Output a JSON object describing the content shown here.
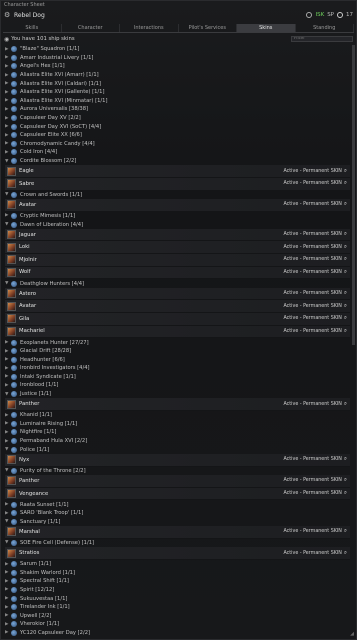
{
  "window": {
    "title": "Character Sheet"
  },
  "header": {
    "character": "Rebel Dog",
    "isk": "ISK",
    "sp": "SP",
    "skillq": "17"
  },
  "tabs": [
    "Skills",
    "Character",
    "Interactions",
    "Pilot's Services",
    "Skins",
    "Standing"
  ],
  "active_tab": 4,
  "count_text": "You have 101 ship skins",
  "filter_placeholder": "Filter",
  "status_label": "Active - Permanent SKIN",
  "rows": [
    {
      "t": "g",
      "exp": false,
      "label": "\"Blaze\" Squadron [1/1]"
    },
    {
      "t": "g",
      "exp": false,
      "label": "Amarr Industrial Livery [1/1]"
    },
    {
      "t": "g",
      "exp": false,
      "label": "Angel's Hex [1/1]"
    },
    {
      "t": "g",
      "exp": false,
      "label": "Aliastra Elite XVI (Amarr) [1/1]"
    },
    {
      "t": "g",
      "exp": false,
      "label": "Aliastra Elite XVI (Caldari) [1/1]"
    },
    {
      "t": "g",
      "exp": false,
      "label": "Aliastra Elite XVI (Gallente) [1/1]"
    },
    {
      "t": "g",
      "exp": false,
      "label": "Aliastra Elite XVI (Minmatar) [1/1]"
    },
    {
      "t": "g",
      "exp": false,
      "label": "Aurora Universalis [38/38]"
    },
    {
      "t": "g",
      "exp": false,
      "label": "Capsuleer Day XV [2/2]"
    },
    {
      "t": "g",
      "exp": false,
      "label": "Capsuleer Day XVI (SoCT) [4/4]"
    },
    {
      "t": "g",
      "exp": false,
      "label": "Capsuleer Elite XX [6/6]"
    },
    {
      "t": "g",
      "exp": false,
      "label": "Chromodynamic Candy [4/4]"
    },
    {
      "t": "g",
      "exp": false,
      "label": "Cold Iron [4/4]"
    },
    {
      "t": "g",
      "exp": true,
      "label": "Cordite Blossom [2/2]"
    },
    {
      "t": "i",
      "label": "Eagle"
    },
    {
      "t": "i",
      "label": "Sabre"
    },
    {
      "t": "g",
      "exp": true,
      "label": "Crown and Swords [1/1]"
    },
    {
      "t": "i",
      "label": "Avatar"
    },
    {
      "t": "g",
      "exp": false,
      "label": "Cryptic Mimesis [1/1]"
    },
    {
      "t": "g",
      "exp": true,
      "label": "Dawn of Liberation [4/4]"
    },
    {
      "t": "i",
      "label": "Jaguar"
    },
    {
      "t": "i",
      "label": "Loki"
    },
    {
      "t": "i",
      "label": "Mjolnir"
    },
    {
      "t": "i",
      "label": "Wolf"
    },
    {
      "t": "g",
      "exp": true,
      "label": "Deathglow Hunters [4/4]"
    },
    {
      "t": "i",
      "label": "Astero"
    },
    {
      "t": "i",
      "label": "Avatar"
    },
    {
      "t": "i",
      "label": "Gila"
    },
    {
      "t": "i",
      "label": "Machariel"
    },
    {
      "t": "g",
      "exp": false,
      "label": "Exoplanets Hunter [27/27]"
    },
    {
      "t": "g",
      "exp": false,
      "label": "Glacial Drift [28/28]"
    },
    {
      "t": "g",
      "exp": false,
      "label": "Headhunter [6/6]"
    },
    {
      "t": "g",
      "exp": false,
      "label": "Ironbird Investigators [4/4]"
    },
    {
      "t": "g",
      "exp": false,
      "label": "Intaki Syndicate [1/1]"
    },
    {
      "t": "g",
      "exp": false,
      "label": "Ironblood [1/1]"
    },
    {
      "t": "g",
      "exp": true,
      "label": "Justice [1/1]"
    },
    {
      "t": "i",
      "label": "Panther"
    },
    {
      "t": "g",
      "exp": false,
      "label": "Khanid [1/1]"
    },
    {
      "t": "g",
      "exp": false,
      "label": "Luminaire Rising [1/1]"
    },
    {
      "t": "g",
      "exp": false,
      "label": "Nightfire [1/1]"
    },
    {
      "t": "g",
      "exp": false,
      "label": "Permaband Hula XVI [2/2]"
    },
    {
      "t": "g",
      "exp": true,
      "label": "Police [1/1]"
    },
    {
      "t": "i",
      "label": "Nyx"
    },
    {
      "t": "g",
      "exp": true,
      "label": "Purity of the Throne [2/2]"
    },
    {
      "t": "i",
      "label": "Panther"
    },
    {
      "t": "i",
      "label": "Vengeance"
    },
    {
      "t": "g",
      "exp": false,
      "label": "Raata Sunset [1/1]"
    },
    {
      "t": "g",
      "exp": false,
      "label": "SARO 'Blank Troop' [1/1]"
    },
    {
      "t": "g",
      "exp": true,
      "label": "Sanctuary [1/1]"
    },
    {
      "t": "i",
      "label": "Marshal"
    },
    {
      "t": "g",
      "exp": true,
      "label": "SOE Fire Cell (Defense) [1/1]"
    },
    {
      "t": "i",
      "label": "Stratios"
    },
    {
      "t": "g",
      "exp": false,
      "label": "Sarum [1/1]"
    },
    {
      "t": "g",
      "exp": false,
      "label": "Shakim Warlord [1/1]"
    },
    {
      "t": "g",
      "exp": false,
      "label": "Spectral Shift [1/1]"
    },
    {
      "t": "g",
      "exp": false,
      "label": "Spirit [12/12]"
    },
    {
      "t": "g",
      "exp": false,
      "label": "Sukuuvestaa [1/1]"
    },
    {
      "t": "g",
      "exp": false,
      "label": "Tirelander Ink [1/1]"
    },
    {
      "t": "g",
      "exp": false,
      "label": "Upwell [2/2]"
    },
    {
      "t": "g",
      "exp": false,
      "label": "Vherokior [1/1]"
    },
    {
      "t": "g",
      "exp": false,
      "label": "YC120 Capsuleer Day [2/2]"
    }
  ]
}
